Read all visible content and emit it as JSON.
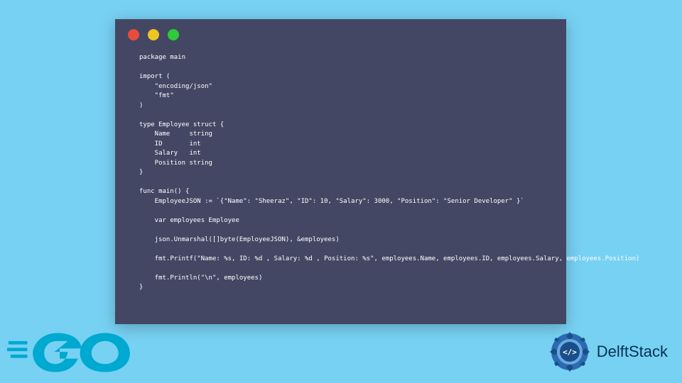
{
  "window": {
    "controls": [
      "close",
      "minimize",
      "zoom"
    ]
  },
  "code": "package main\n\nimport (\n    \"encoding/json\"\n    \"fmt\"\n)\n\ntype Employee struct {\n    Name     string\n    ID       int\n    Salary   int\n    Position string\n}\n\nfunc main() {\n    EmployeeJSON := `{\"Name\": \"Sheeraz\", \"ID\": 10, \"Salary\": 3000, \"Position\": \"Senior Developer\" }`\n\n    var employees Employee\n\n    json.Unmarshal([]byte(EmployeeJSON), &employees)\n\n    fmt.Printf(\"Name: %s, ID: %d , Salary: %d , Position: %s\", employees.Name, employees.ID, employees.Salary, employees.Position)\n\n    fmt.Println(\"\\n\", employees)\n}",
  "logos": {
    "go": "Go",
    "delft": "DelftStack"
  }
}
